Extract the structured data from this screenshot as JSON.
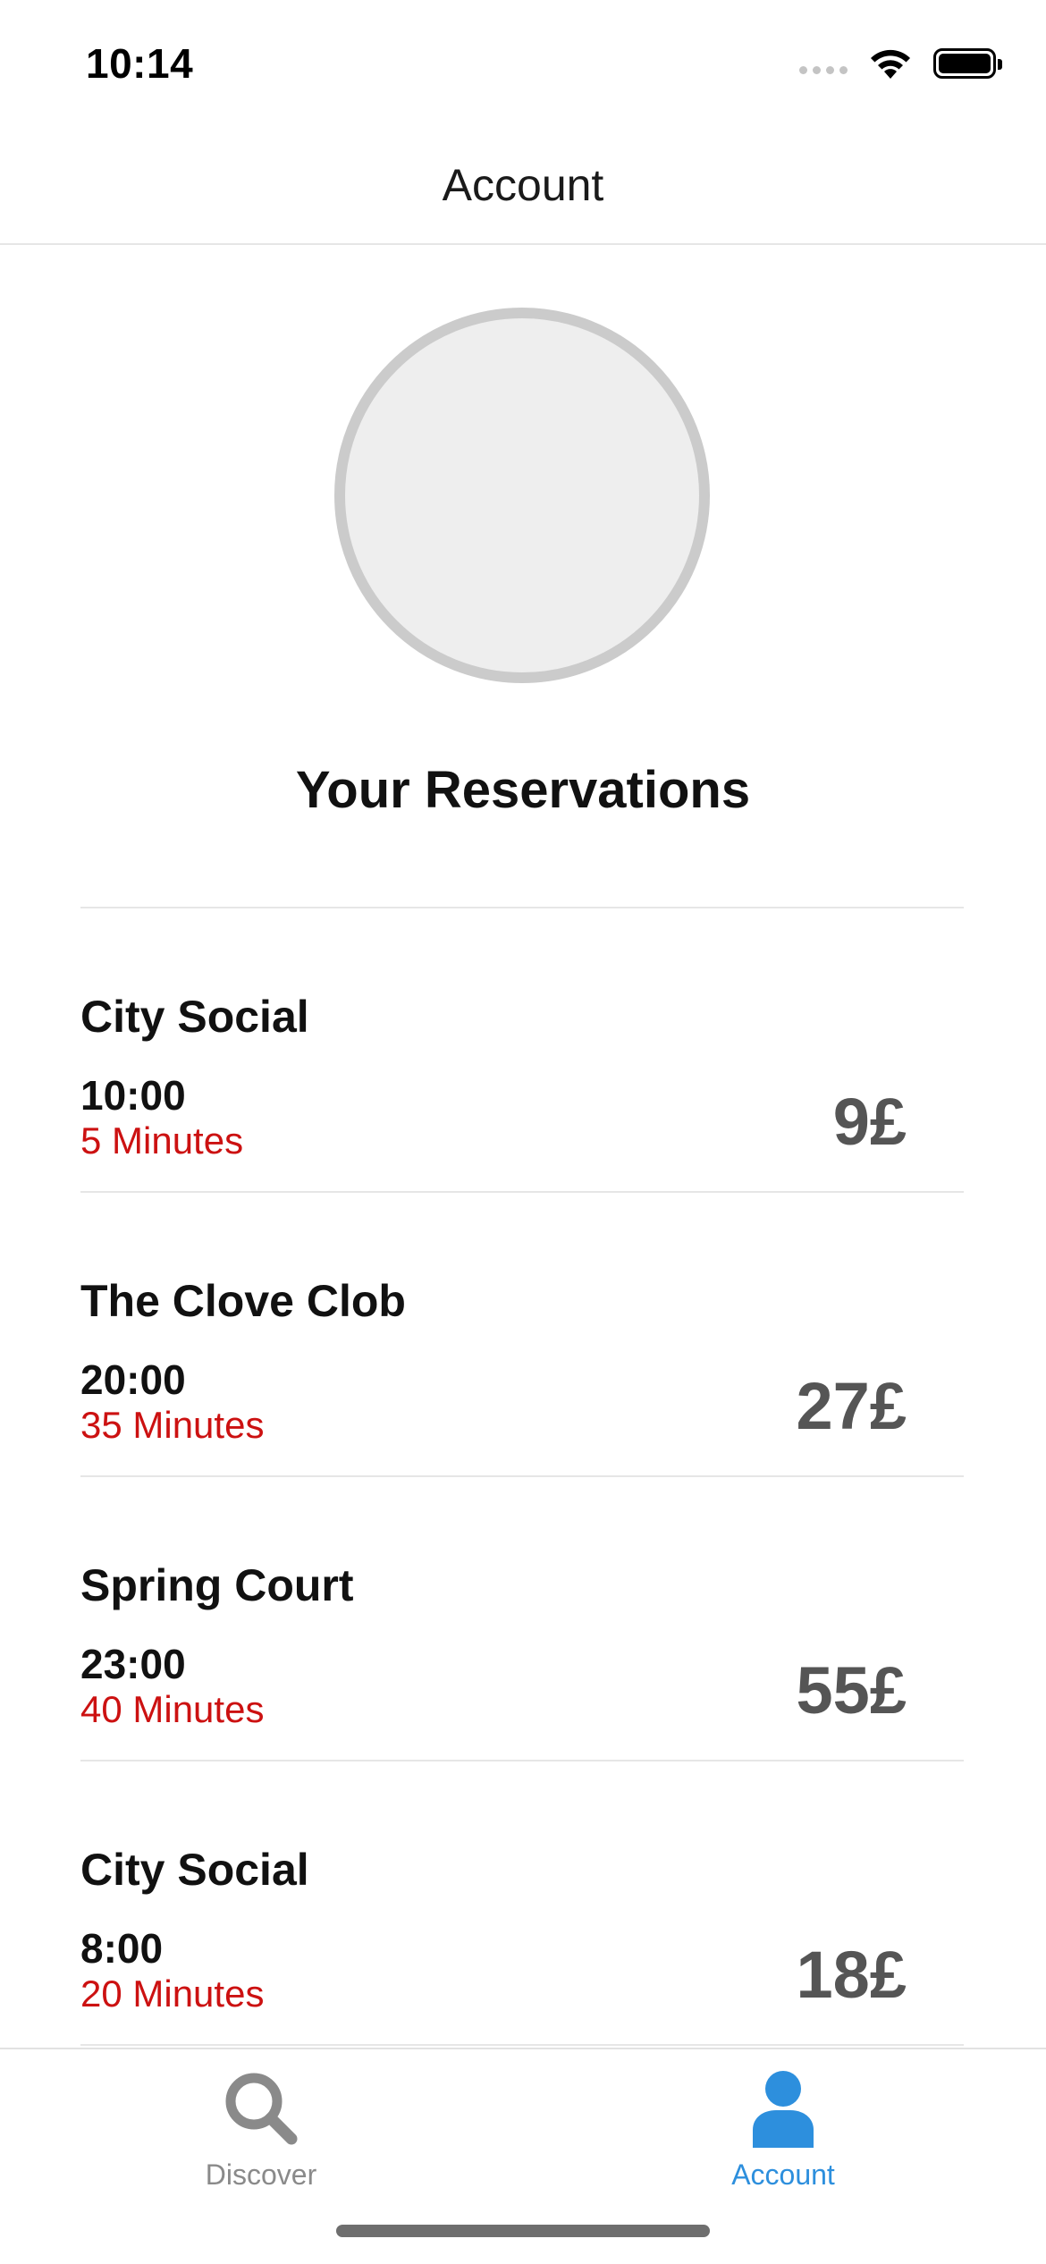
{
  "status_bar": {
    "time": "10:14",
    "icons": [
      "signal-dots-icon",
      "wifi-icon",
      "battery-icon"
    ]
  },
  "nav": {
    "title": "Account"
  },
  "profile": {
    "avatar": "avatar-placeholder"
  },
  "reservations_section": {
    "title": "Your Reservations"
  },
  "reservations": [
    {
      "name": "City Social",
      "time": "10:00",
      "duration": "5 Minutes",
      "price": "9£"
    },
    {
      "name": "The Clove Clob",
      "time": "20:00",
      "duration": "35 Minutes",
      "price": "27£"
    },
    {
      "name": "Spring Court",
      "time": "23:00",
      "duration": "40 Minutes",
      "price": "55£"
    },
    {
      "name": "City Social",
      "time": "8:00",
      "duration": "20 Minutes",
      "price": "18£"
    }
  ],
  "tab_bar": {
    "tabs": [
      {
        "label": "Discover",
        "icon": "search-icon",
        "active": false
      },
      {
        "label": "Account",
        "icon": "person-icon",
        "active": true
      }
    ]
  },
  "colors": {
    "accent": "#2d8fdd",
    "duration_red": "#cc1111",
    "price_gray": "#555555",
    "inactive_gray": "#8a8a8a"
  }
}
